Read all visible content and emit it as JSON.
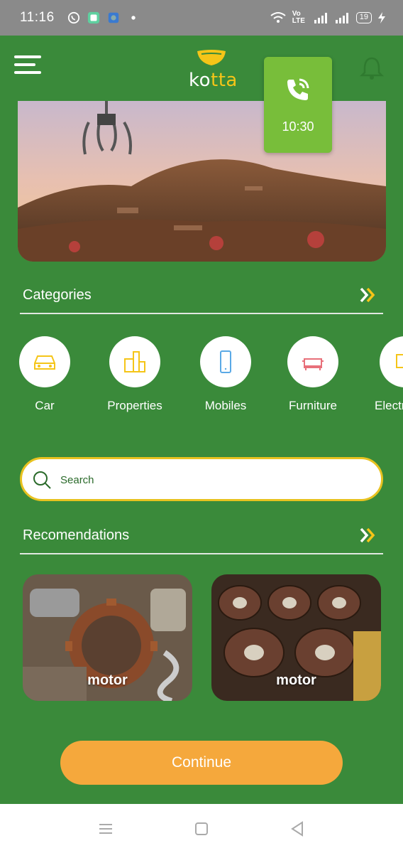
{
  "status_bar": {
    "time": "11:16",
    "network_label": "Vo LTE",
    "battery": "19"
  },
  "header": {
    "logo_text_k": "ko",
    "logo_text_tta": "tta"
  },
  "call_card": {
    "time": "10:30"
  },
  "categories": {
    "title": "Categories",
    "items": [
      {
        "label": "Car",
        "icon": "car-icon",
        "color": "#f5c518"
      },
      {
        "label": "Properties",
        "icon": "building-icon",
        "color": "#f5c518"
      },
      {
        "label": "Mobiles",
        "icon": "phone-icon",
        "color": "#5aa9e6"
      },
      {
        "label": "Furniture",
        "icon": "sofa-icon",
        "color": "#e8707a"
      },
      {
        "label": "Electr",
        "icon": "electronics-icon",
        "color": "#f5c518"
      }
    ]
  },
  "search": {
    "placeholder": "Search"
  },
  "recommendations": {
    "title": "Recomendations",
    "items": [
      {
        "label": "motor"
      },
      {
        "label": "motor"
      }
    ]
  },
  "continue_button": {
    "label": "Continue"
  },
  "colors": {
    "primary_green": "#3a8a3a",
    "call_green": "#78be3a",
    "accent_yellow": "#f5c518",
    "continue_orange": "#f5a83c"
  }
}
